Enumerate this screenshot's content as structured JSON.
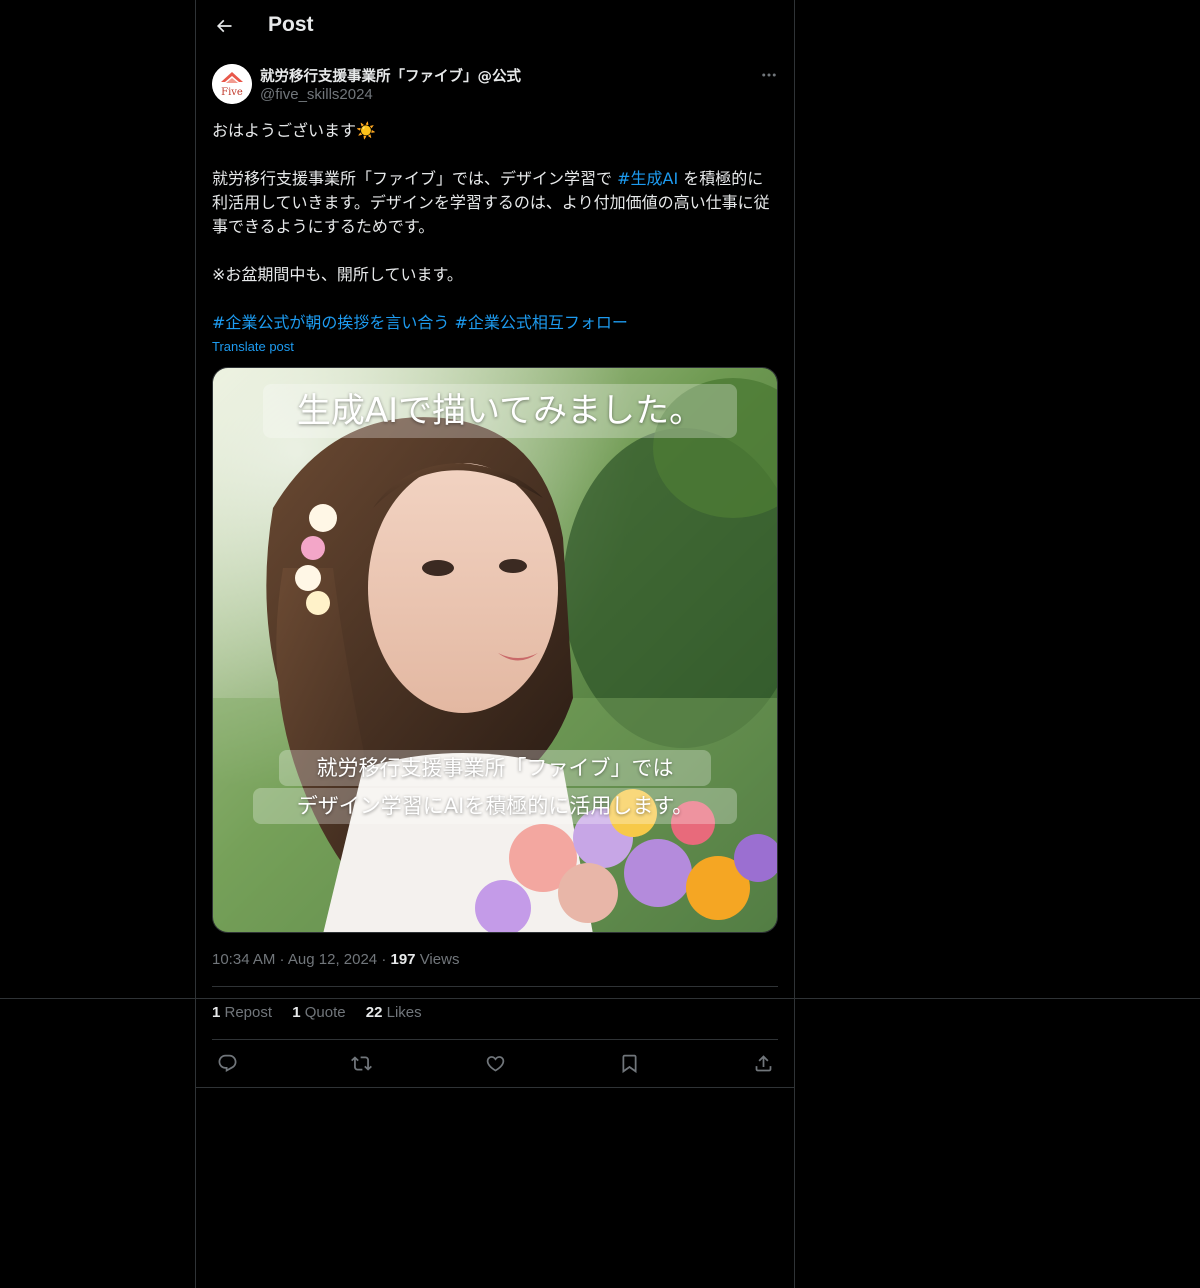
{
  "header": {
    "title": "Post"
  },
  "author": {
    "display_name": "就労移行支援事業所「ファイブ」@公式",
    "handle": "@five_skills2024",
    "avatar_text": "Five"
  },
  "post": {
    "line1": "おはようございます☀️",
    "para2_a": "就労移行支援事業所「ファイブ」では、デザイン学習で ",
    "para2_tag": "#生成AI",
    "para2_b": " を積極的に利活用していきます。デザインを学習するのは、より付加価値の高い仕事に従事できるようにするためです。",
    "para3": "※お盆期間中も、開所しています。",
    "tag1": "#企業公式が朝の挨拶を言い合う",
    "tag2": "#企業公式相互フォロー",
    "translate": "Translate post"
  },
  "media": {
    "caption_top": "生成AIで描いてみました。",
    "caption_line1": "就労移行支援事業所「ファイブ」では",
    "caption_line2": "デザイン学習にAIを積極的に活用します。"
  },
  "meta": {
    "time": "10:34 AM",
    "sep1": " · ",
    "date": "Aug 12, 2024",
    "sep2": " · ",
    "views_count": "197",
    "views_label": " Views"
  },
  "stats": {
    "reposts_count": "1",
    "reposts_label": " Repost",
    "quotes_count": "1",
    "quotes_label": " Quote",
    "likes_count": "22",
    "likes_label": " Likes"
  },
  "actions": [
    "reply-icon",
    "repost-icon",
    "like-icon",
    "bookmark-icon",
    "share-icon"
  ],
  "colors": {
    "background": "#000000",
    "text": "#e7e9ea",
    "secondary": "#71767b",
    "accent": "#1d9bf0",
    "border": "#2f3336"
  }
}
